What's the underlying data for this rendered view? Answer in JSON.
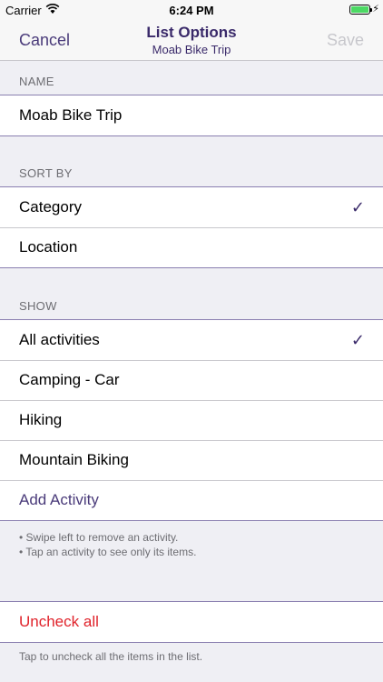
{
  "status": {
    "carrier": "Carrier",
    "time": "6:24 PM"
  },
  "nav": {
    "cancel": "Cancel",
    "title": "List Options",
    "subtitle": "Moab Bike Trip",
    "save": "Save"
  },
  "name_section": {
    "header": "NAME",
    "value": "Moab Bike Trip"
  },
  "sort_section": {
    "header": "SORT BY",
    "items": [
      {
        "label": "Category",
        "checked": true
      },
      {
        "label": "Location",
        "checked": false
      }
    ]
  },
  "show_section": {
    "header": "SHOW",
    "items": [
      {
        "label": "All activities",
        "checked": true
      },
      {
        "label": "Camping - Car",
        "checked": false
      },
      {
        "label": "Hiking",
        "checked": false
      },
      {
        "label": "Mountain Biking",
        "checked": false
      }
    ],
    "add_label": "Add Activity",
    "note_lines": [
      "• Swipe left to remove an activity.",
      "• Tap an activity to see only its items."
    ]
  },
  "uncheck_section": {
    "button": "Uncheck all",
    "note": "Tap to uncheck all the items in the list."
  },
  "colors": {
    "accent": "#3a2a6a",
    "destructive": "#e0232b",
    "background": "#efeff4"
  }
}
